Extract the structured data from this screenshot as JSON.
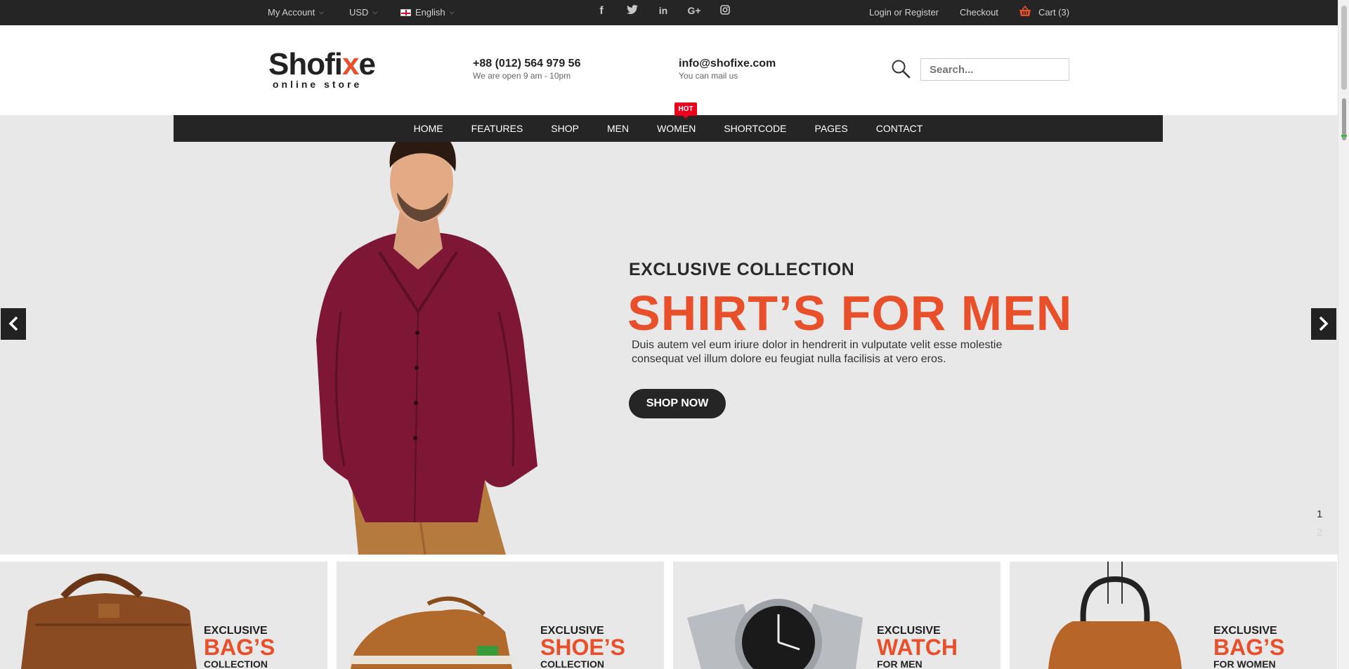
{
  "topbar": {
    "account": "My Account",
    "currency": "USD",
    "language": "English",
    "social": [
      "f",
      "t",
      "in",
      "G+",
      "ig"
    ],
    "login": "Login or Register",
    "checkout": "Checkout",
    "cart": "Cart (3)"
  },
  "header": {
    "logo_main_a": "Shofi",
    "logo_main_x": "x",
    "logo_main_b": "e",
    "logo_tag": "online store",
    "phone": "+88 (012) 564 979 56",
    "phone_note": "We are open 9 am - 10pm",
    "email": "info@shofixe.com",
    "email_note": "You can mail us",
    "search_placeholder": "Search..."
  },
  "nav": {
    "items": [
      "HOME",
      "FEATURES",
      "SHOP",
      "MEN",
      "WOMEN",
      "SHORTCODE",
      "PAGES",
      "CONTACT"
    ],
    "badge": "HOT"
  },
  "hero": {
    "subtitle": "EXCLUSIVE COLLECTION",
    "title": "SHIRT’S FOR MEN",
    "text_line1": "Duis autem vel eum iriure dolor in hendrerit in vulputate velit esse molestie",
    "text_line2": "consequat vel illum dolore eu feugiat nulla facilisis at vero eros.",
    "button": "SHOP NOW",
    "prev": "‹",
    "next": "›",
    "page1": "1",
    "page2": "2"
  },
  "categories": [
    {
      "label": "EXCLUSIVE",
      "title": "BAG’S",
      "sub": "COLLECTION"
    },
    {
      "label": "EXCLUSIVE",
      "title": "SHOE’S",
      "sub": "COLLECTION"
    },
    {
      "label": "EXCLUSIVE",
      "title": "WATCH",
      "sub": "FOR MEN"
    },
    {
      "label": "EXCLUSIVE",
      "title": "BAG’S",
      "sub": "FOR WOMEN"
    }
  ],
  "colors": {
    "accent": "#e8502b",
    "dark": "#252525",
    "hero_bg": "#e8e8e8",
    "hot": "#e8001c"
  }
}
